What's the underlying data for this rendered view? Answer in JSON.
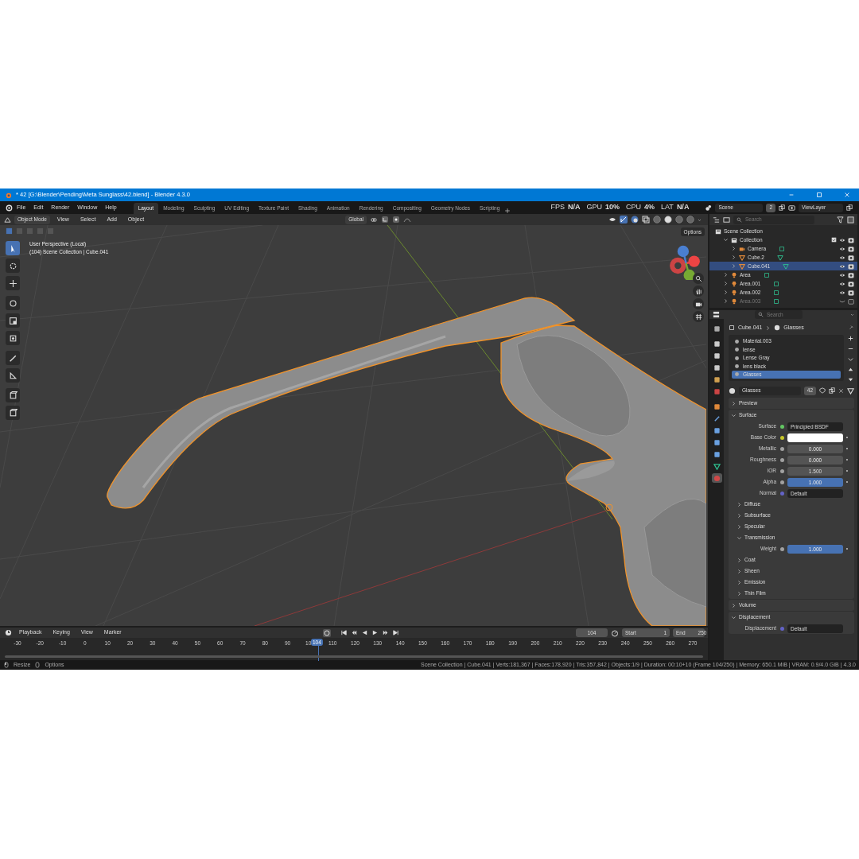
{
  "window": {
    "title": "* 42 [G:\\Blender\\Pending\\Meta Sunglass\\42.blend] - Blender 4.3.0"
  },
  "menu": [
    "File",
    "Edit",
    "Render",
    "Window",
    "Help"
  ],
  "workspaces": [
    {
      "label": "Layout",
      "selected": true
    },
    {
      "label": "Modeling",
      "selected": false
    },
    {
      "label": "Sculpting",
      "selected": false
    },
    {
      "label": "UV Editing",
      "selected": false
    },
    {
      "label": "Texture Paint",
      "selected": false
    },
    {
      "label": "Shading",
      "selected": false
    },
    {
      "label": "Animation",
      "selected": false
    },
    {
      "label": "Rendering",
      "selected": false
    },
    {
      "label": "Compositing",
      "selected": false
    },
    {
      "label": "Geometry Nodes",
      "selected": false
    },
    {
      "label": "Scripting",
      "selected": false
    }
  ],
  "stats": [
    {
      "label": "FPS",
      "value": "N/A"
    },
    {
      "label": "GPU",
      "value": "10%"
    },
    {
      "label": "CPU",
      "value": "4%"
    },
    {
      "label": "LAT",
      "value": "N/A"
    }
  ],
  "scene": {
    "name": "Scene",
    "users": "2",
    "view_layer": "ViewLayer"
  },
  "viewport": {
    "mode": "Object Mode",
    "menus": [
      "View",
      "Select",
      "Add",
      "Object"
    ],
    "orientation": "Global",
    "options": "Options",
    "overlay_lines": [
      "User Perspective (Local)",
      "(104) Scene Collection | Cube.041"
    ],
    "shading_modes": [
      {
        "selected": false
      },
      {
        "selected": true
      },
      {
        "selected": false
      },
      {
        "selected": false
      }
    ]
  },
  "outliner": {
    "search_placeholder": "Search",
    "items": [
      {
        "name": "Scene Collection",
        "kind": "scene",
        "selected": false,
        "visible": true,
        "children": [
          {
            "name": "Collection",
            "kind": "collection",
            "selected": false,
            "visible": true,
            "expanded": true,
            "children": [
              {
                "name": "Camera",
                "kind": "camera",
                "selected": false,
                "visible": true,
                "expanded": false
              },
              {
                "name": "Cube.2",
                "kind": "mesh",
                "selected": false,
                "visible": true,
                "expanded": false
              },
              {
                "name": "Cube.041",
                "kind": "mesh",
                "selected": true,
                "visible": true,
                "expanded": false
              }
            ]
          },
          {
            "name": "Area",
            "kind": "light",
            "selected": false,
            "visible": true,
            "expanded": false
          },
          {
            "name": "Area.001",
            "kind": "light",
            "selected": false,
            "visible": true,
            "expanded": false
          },
          {
            "name": "Area.002",
            "kind": "light",
            "selected": false,
            "visible": true,
            "expanded": false
          },
          {
            "name": "Area.003",
            "kind": "light",
            "selected": false,
            "visible": false,
            "expanded": false
          }
        ]
      }
    ]
  },
  "properties": {
    "search_placeholder": "Search",
    "breadcrumb": [
      "Cube.041",
      "Glasses"
    ],
    "tabs": [
      {
        "selected": false
      },
      {
        "selected": false
      },
      {
        "selected": false
      },
      {
        "selected": false
      },
      {
        "selected": false
      },
      {
        "selected": false
      },
      {
        "selected": false
      },
      {
        "selected": false
      },
      {
        "selected": false
      },
      {
        "selected": false
      },
      {
        "selected": false
      },
      {
        "selected": false
      },
      {
        "selected": true
      }
    ],
    "material_slots": [
      {
        "name": "Material.003",
        "selected": false
      },
      {
        "name": "lense",
        "selected": false
      },
      {
        "name": "Lense Gray",
        "selected": false
      },
      {
        "name": "lens black",
        "selected": false
      },
      {
        "name": "Glasses",
        "selected": true
      }
    ],
    "material": {
      "name": "Glasses",
      "users": "42"
    },
    "panels": [
      {
        "title": "Preview",
        "expanded": false
      },
      {
        "title": "Surface",
        "expanded": true,
        "rows": [
          {
            "kind": "link",
            "label": "Surface",
            "value": "Principled BSDF",
            "color": "#63c763"
          },
          {
            "kind": "swatch",
            "label": "Base Color",
            "color": "#c7c729"
          },
          {
            "kind": "factor",
            "label": "Metallic",
            "value": "0.000",
            "level": 0,
            "color": "#a1a1a1"
          },
          {
            "kind": "factor",
            "label": "Roughness",
            "value": "0.000",
            "level": 0,
            "color": "#a1a1a1"
          },
          {
            "kind": "number",
            "label": "IOR",
            "value": "1.500",
            "color": "#a1a1a1"
          },
          {
            "kind": "factor",
            "label": "Alpha",
            "value": "1.000",
            "level": 1,
            "color": "#a1a1a1"
          },
          {
            "kind": "link",
            "label": "Normal",
            "value": "Default",
            "color": "#6363c7"
          }
        ],
        "subpanels": [
          {
            "title": "Diffuse",
            "expanded": false
          },
          {
            "title": "Subsurface",
            "expanded": false
          },
          {
            "title": "Specular",
            "expanded": false
          },
          {
            "title": "Transmission",
            "expanded": true,
            "rows": [
              {
                "kind": "factor",
                "label": "Weight",
                "value": "1.000",
                "level": 1,
                "color": "#a1a1a1"
              }
            ]
          },
          {
            "title": "Coat",
            "expanded": false
          },
          {
            "title": "Sheen",
            "expanded": false
          },
          {
            "title": "Emission",
            "expanded": false
          },
          {
            "title": "Thin Film",
            "expanded": false
          }
        ]
      },
      {
        "title": "Volume",
        "expanded": false
      },
      {
        "title": "Displacement",
        "expanded": true,
        "rows": [
          {
            "kind": "link",
            "label": "Displacement",
            "value": "Default",
            "color": "#6363c7"
          }
        ]
      }
    ]
  },
  "timeline": {
    "menus": [
      "Playback",
      "Keying",
      "View",
      "Marker"
    ],
    "current_frame": "104",
    "start_label": "Start",
    "start": "1",
    "end_label": "End",
    "end": "250",
    "ticks": [
      "-30",
      "-20",
      "-10",
      "0",
      "10",
      "20",
      "30",
      "40",
      "50",
      "60",
      "70",
      "80",
      "90",
      "10",
      "110",
      "120",
      "130",
      "140",
      "150",
      "160",
      "170",
      "180",
      "190",
      "200",
      "210",
      "220",
      "230",
      "240",
      "250",
      "260",
      "270"
    ],
    "marker": "104"
  },
  "status_bar": {
    "hints": [
      "Resize",
      "Options"
    ],
    "info": "Scene Collection | Cube.041 | Verts:181,367 | Faces:178,920 | Tris:357,842 | Objects:1/9 | Duration: 00:10+10 (Frame 104/250) | Memory: 650.1 MiB | VRAM: 0.9/4.0 GiB | 4.3.0"
  }
}
